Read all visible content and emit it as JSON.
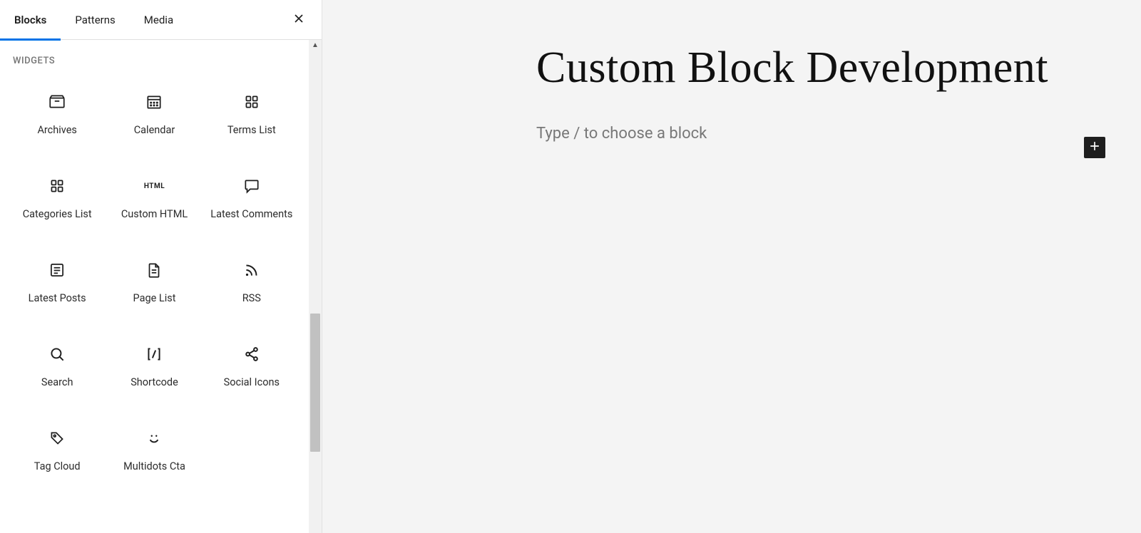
{
  "tabs": {
    "blocks": "Blocks",
    "patterns": "Patterns",
    "media": "Media"
  },
  "section_label": "Widgets",
  "blocks": [
    {
      "label": "Archives",
      "icon": "archives"
    },
    {
      "label": "Calendar",
      "icon": "calendar"
    },
    {
      "label": "Terms List",
      "icon": "terms"
    },
    {
      "label": "Categories List",
      "icon": "categories"
    },
    {
      "label": "Custom HTML",
      "icon": "html"
    },
    {
      "label": "Latest Comments",
      "icon": "comments"
    },
    {
      "label": "Latest Posts",
      "icon": "latestposts"
    },
    {
      "label": "Page List",
      "icon": "pagelist"
    },
    {
      "label": "RSS",
      "icon": "rss"
    },
    {
      "label": "Search",
      "icon": "search"
    },
    {
      "label": "Shortcode",
      "icon": "shortcode"
    },
    {
      "label": "Social Icons",
      "icon": "social"
    },
    {
      "label": "Tag Cloud",
      "icon": "tagcloud"
    },
    {
      "label": "Multidots Cta",
      "icon": "smile"
    }
  ],
  "editor": {
    "title": "Custom Block Development",
    "placeholder": "Type / to choose a block"
  }
}
